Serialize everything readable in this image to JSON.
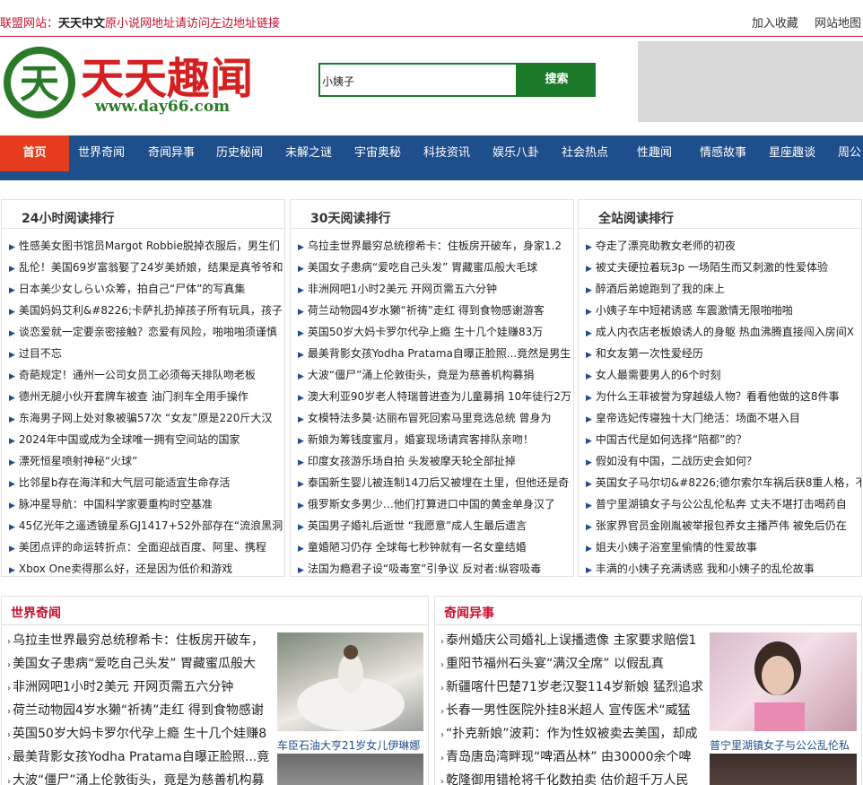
{
  "topbar": {
    "label": "联盟网站：",
    "site": "天天中文",
    "message": "原小说网地址请访问左边地址链接",
    "links": [
      "加入收藏",
      "网站地图"
    ]
  },
  "logo": {
    "text": "天天趣闻",
    "url": "www.day66.com",
    "glyph": "天"
  },
  "search": {
    "value": "小姨子",
    "button": "搜索"
  },
  "nav": {
    "items": [
      "首页",
      "世界奇闻",
      "奇闻异事",
      "历史秘闻",
      "未解之谜",
      "宇宙奥秘",
      "科技资讯",
      "娱乐八卦",
      "社会热点",
      "性趣闻",
      "情感故事",
      "星座趣谈",
      "周公"
    ]
  },
  "rank_24h": {
    "title": "24小时阅读排行",
    "items": [
      "性感美女图书馆员Margot Robbie脱掉衣服后，男生们",
      "乱伦！美国69岁富翁娶了24岁美娇娘，结果是真爷爷和",
      "日本美少女しらい众筹，拍自己“尸体”的写真集",
      "美国妈妈艾利&#8226;卡萨扎扔掉孩子所有玩具，孩子",
      "谈恋爱就一定要亲密接触？恋爱有风险，啪啪啪须谨慎",
      "过目不忘",
      "奇葩规定！通州一公司女员工必须每天排队吻老板",
      "德州无腿小伙开套牌车被查 油门刹车全用手操作",
      "东海男子网上处对象被骗57次 “女友”原是220斤大汉",
      "2024年中国或成为全球唯一拥有空间站的国家",
      "漂死恒星喷射神秘“火球”",
      "比邻星b存在海洋和大气层可能适宜生命存活",
      "脉冲星导航：中国科学家要重构时空基准",
      "45亿光年之遥透镜星系GJ1417+52外部存在“流浪黑洞",
      "美团点评的命运转折点：全面迎战百度、阿里、携程",
      "Xbox One卖得那么好，还是因为低价和游戏"
    ]
  },
  "rank_30d": {
    "title": "30天阅读排行",
    "items": [
      "乌拉圭世界最穷总统穆希卡：住板房开破车，身家1.2",
      "美国女子患病“爱吃自己头发” 胃藏蜜瓜般大毛球",
      "非洲网吧1小时2美元 开网页需五六分钟",
      "荷兰动物园4岁水獭“祈祷”走红 得到食物感谢游客",
      "英国50岁大妈卡罗尔代孕上瘾 生十几个娃赚83万",
      "最美背影女孩Yodha Pratama自曝正脸照...竟然是男生",
      "大波“僵尸”涌上伦敦街头，竟是为慈善机构募捐",
      "澳大利亚90岁老人特瑞普进查为儿童募捐 10年徒行2万",
      "女模特法多莫·达丽布冒死回索马里竞选总统 曾身为",
      "新娘为筹钱度蜜月，婚宴现场请宾客排队亲吻！",
      "印度女孩游乐场自拍 头发被摩天轮全部扯掉",
      "泰国新生婴儿被连制14刀后又被埋在土里，但他还是奇",
      "俄罗斯女多男少…他们打算进口中国的黄金单身汉了",
      "英国男子婚礼后逝世 “我愿意”成人生最后遗言",
      "童婚陋习仍存 全球每七秒钟就有一名女童结婚",
      "法国为瘾君子设“吸毒室”引争议 反对者:纵容吸毒"
    ]
  },
  "rank_all": {
    "title": "全站阅读排行",
    "items": [
      "夺走了漂亮助教女老师的初夜",
      "被丈夫硬拉着玩3p 一场陌生而又刺激的性爱体验",
      "醉酒后弟媳跑到了我的床上",
      "小姨子车中短裙诱惑 车震激情无限啪啪啪",
      "成人内衣店老板娘诱人的身躯 热血沸腾直接闯入房间X",
      "和女友第一次性爱经历",
      "女人最需要男人的6个时刻",
      "为什么王菲被誉为穿越级人物？看看他做的这8件事",
      "皇帝选妃传寝独十大门绝活：场面不堪入目",
      "中国古代是如何选择“陪都”的？",
      "假如没有中国，二战历史会如何？",
      "英国女子马尔切&#8226;德尔索尔车祸后获8重人格，不",
      "普宁里湖镇女子与公公乱伦私奔 丈夫不堪打击喝药自",
      "张家界官员金刚胤被举报包养女主播芦伟 被免后仍在",
      "姐夫小姨子浴室里偷情的性爱故事",
      "丰满的小姨子充满诱惑 我和小姨子的乱伦故事"
    ]
  },
  "section_world": {
    "title": "世界奇闻",
    "items": [
      "乌拉圭世界最穷总统穆希卡：住板房开破车，",
      "美国女子患病“爱吃自己头发” 胃藏蜜瓜般大",
      "非洲网吧1小时2美元 开网页需五六分钟",
      "荷兰动物园4岁水獭“祈祷”走红 得到食物感谢",
      "英国50岁大妈卡罗尔代孕上瘾 生十几个娃赚8",
      "最美背影女孩Yodha Pratama自曝正脸照...竟",
      "大波“僵尸”涌上伦敦街头，竟是为慈善机构募"
    ],
    "caption": "车臣石油大亨21岁女儿伊琳娜"
  },
  "section_odd": {
    "title": "奇闻异事",
    "items": [
      "泰州婚庆公司婚礼上误播遗像 主家要求赔偿1",
      "重阳节福州石头宴“满汉全席” 以假乱真",
      "新疆喀什巴楚71岁老汉娶114岁新娘 猛烈追求",
      "长春一男性医院外挂8米超人 宣传医术“威猛",
      "“扑克新娘”波莉：作为性奴被卖去美国，却成",
      "青岛唐岛湾畔现“啤酒丛林” 由30000余个啤",
      "乾隆御用错枪将千化数拍卖 估价超千万人民"
    ],
    "caption": "普宁里湖镇女子与公公乱伦私"
  },
  "colors": {
    "brand_red": "#c8102e",
    "nav_blue": "#1f4e8c",
    "home_orange": "#e43c1c",
    "search_green": "#1a7a2a"
  }
}
